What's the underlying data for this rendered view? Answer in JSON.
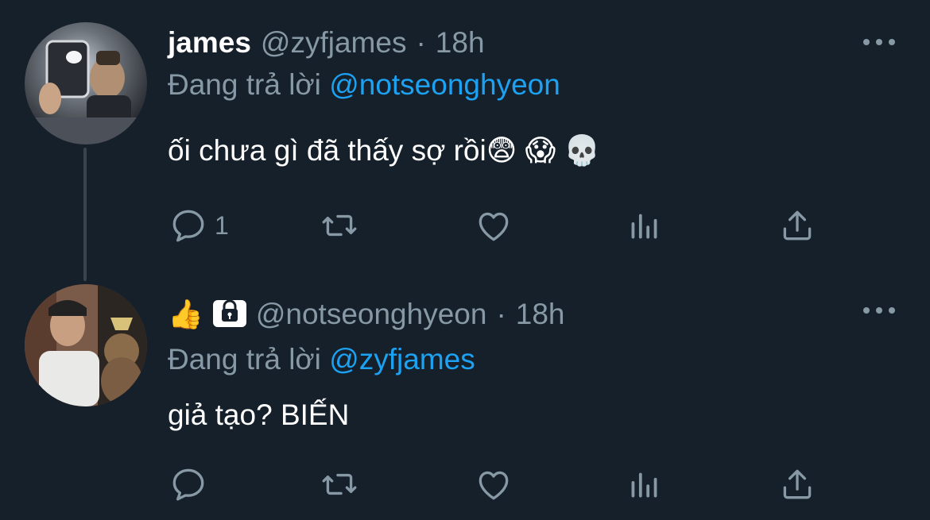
{
  "tweets": [
    {
      "display_name": "james",
      "handle": "@zyfjames",
      "separator": "·",
      "time": "18h",
      "reply_prefix": "Đang trả lời",
      "reply_mention": "@notseonghyeon",
      "text": "ối chưa gì đã thấy sợ rồi😨 😱 💀",
      "reply_count": "1",
      "avatar_icon": "user-avatar-photo"
    },
    {
      "name_emoji": "👍",
      "handle": "@notseonghyeon",
      "separator": "·",
      "time": "18h",
      "reply_prefix": "Đang trả lời",
      "reply_mention": "@zyfjames",
      "text": "giả tạo? BIẾN",
      "reply_count": "",
      "avatar_icon": "user-avatar-photo",
      "protected_icon": "lock-icon"
    }
  ],
  "colors": {
    "background": "#15202b",
    "muted": "#8899a6",
    "link": "#1da1f2",
    "thread_line": "#38444d"
  }
}
